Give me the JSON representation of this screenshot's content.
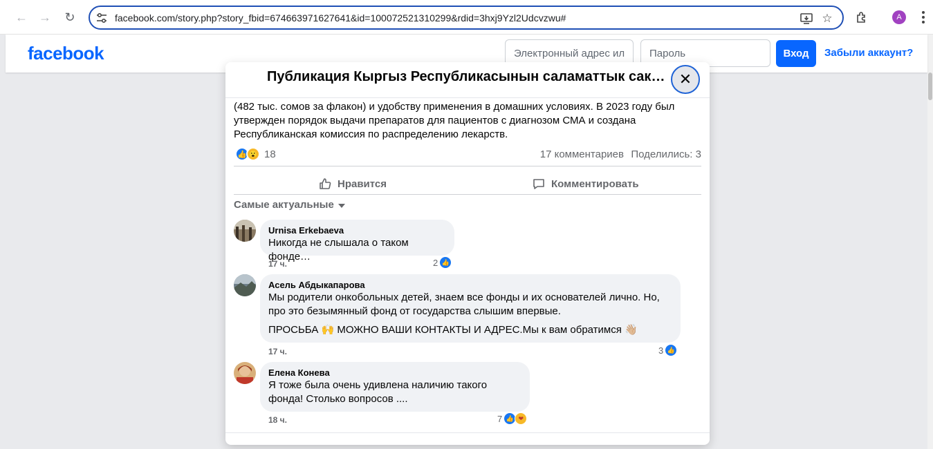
{
  "browser": {
    "url": "facebook.com/story.php?story_fbid=674663971627641&id=100072521310299&rdid=3hxj9Yzl2Udcvzwu#",
    "profile_initial": "A",
    "icons": [
      "back-arrow-icon",
      "forward-arrow-icon",
      "reload-icon",
      "site-settings-icon",
      "install-app-icon",
      "bookmark-star-icon",
      "extensions-icon",
      "menu-kebab-icon"
    ]
  },
  "header": {
    "logo": "facebook",
    "email_placeholder": "Электронный адрес ил",
    "password_placeholder": "Пароль",
    "login_label": "Вход",
    "forgot_label": "Забыли аккаунт?",
    "brand_color": "#0866ff"
  },
  "post": {
    "title": "Публикация Кыргыз Республикасынын саламаттык сак…",
    "text": "(482 тыс. сомов за флакон) и удобству применения в домашних условиях. В 2023 году был утвержден порядок выдачи препаратов для пациентов с диагнозом СМА и создана Республиканская комиссия по распределению лекарств.",
    "reactions_count": "18",
    "reaction_types": [
      "like",
      "wow"
    ],
    "comments_count": "17 комментариев",
    "shares_count": "Поделились: 3",
    "like_label": "Нравится",
    "comment_label": "Комментировать",
    "sort_label": "Самые актуальные"
  },
  "comments": [
    {
      "author": "Urnisa Erkebaeva",
      "text": "Никогда не слышала о таком фонде…",
      "time": "17 ч.",
      "reactions": "2"
    },
    {
      "author": "Асель Абдыкапарова",
      "text": "Мы родители онкобольных детей, знаем все фонды и их основателей лично. Но, про это безымянный фонд от государства слышим впервые.",
      "text2": "ПРОСЬБА 🙌 МОЖНО ВАШИ КОНТАКТЫ И АДРЕС.Мы к вам обратимся 👋🏼",
      "time": "17 ч.",
      "reactions": "3"
    },
    {
      "author": "Елена Конева",
      "text": "Я тоже была очень удивлена наличию такого фонда! Столько вопросов ....",
      "time": "18 ч.",
      "reactions": "7"
    }
  ]
}
